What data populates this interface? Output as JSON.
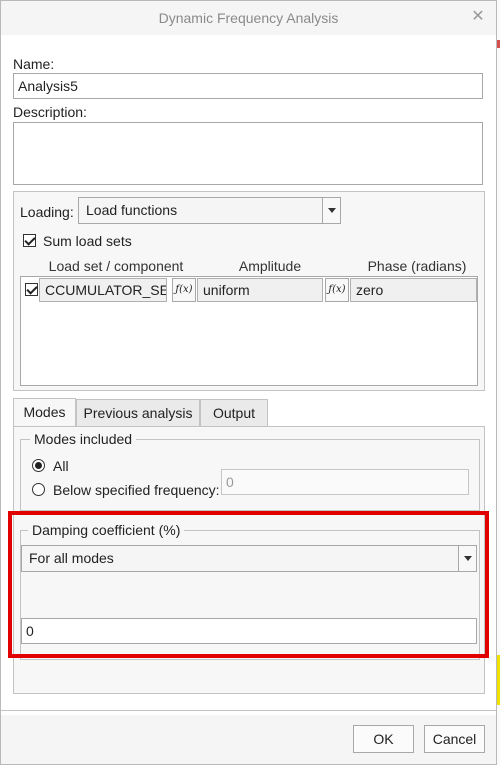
{
  "window": {
    "title": "Dynamic Frequency Analysis",
    "close_glyph": "✕"
  },
  "name": {
    "label": "Name:",
    "value": "Analysis5"
  },
  "description": {
    "label": "Description:",
    "value": ""
  },
  "loading": {
    "label": "Loading:",
    "selected": "Load functions"
  },
  "sum_load_sets": {
    "label": "Sum load sets",
    "checked": true
  },
  "load_table": {
    "headers": [
      "Load set / component",
      "Amplitude",
      "Phase (radians)"
    ],
    "rows": [
      {
        "checked": true,
        "load_set": "CCUMULATOR_SET",
        "amplitude": "uniform",
        "phase": "zero"
      }
    ],
    "fx_glyph": "ƒ(x)"
  },
  "tabs": [
    {
      "label": "Modes",
      "active": true
    },
    {
      "label": "Previous analysis",
      "active": false
    },
    {
      "label": "Output",
      "active": false
    }
  ],
  "modes_included": {
    "legend": "Modes included",
    "options": [
      {
        "label": "All",
        "selected": true
      },
      {
        "label": "Below specified frequency:",
        "selected": false
      }
    ],
    "frequency_value": "0"
  },
  "damping": {
    "legend": "Damping coefficient (%)",
    "selected": "For all modes",
    "value": "0"
  },
  "buttons": {
    "ok": "OK",
    "cancel": "Cancel"
  },
  "colors": {
    "highlight": "#e00000",
    "accent_bg": "#ffffff"
  }
}
